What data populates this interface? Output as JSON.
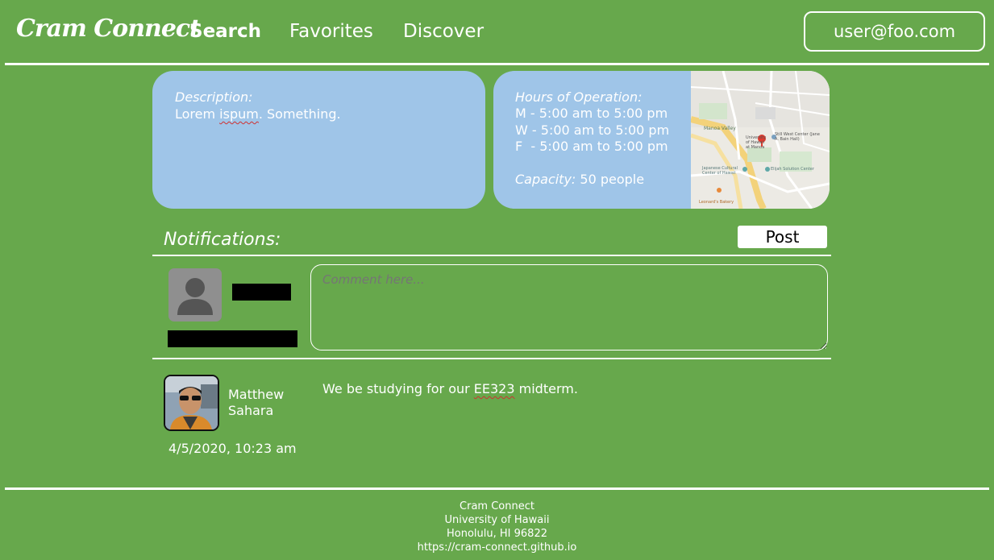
{
  "navbar": {
    "brand": "Cram Connect",
    "links": [
      "Search",
      "Favorites",
      "Discover"
    ],
    "user": "user@foo.com"
  },
  "description_card": {
    "label": "Description:",
    "text_word1": "Lorem",
    "text_word2": "ispum",
    "text_rest": ". Something."
  },
  "hours_card": {
    "label": "Hours of Operation:",
    "lines": [
      "M - 5:00 am to 5:00 pm",
      "W - 5:00 am to 5:00 pm",
      "F  - 5:00 am to 5:00 pm"
    ],
    "capacity_label": "Capacity:",
    "capacity_value": " 50 people"
  },
  "map": {
    "labels": [
      "Manoa Valley",
      "University of Hawaii at Manoa",
      "Still West Center (Jane A. Bain Hall)",
      "Japanese Cultural Center of Hawaii",
      "Elijah Solution Center",
      "Leonard's Bakery"
    ]
  },
  "notifications": {
    "title": "Notifications:",
    "post_button": "Post",
    "comment_placeholder": "Comment here..."
  },
  "posted_note": {
    "name": "Matthew Sahara",
    "date": "4/5/2020, 10:23 am",
    "text_before": "We be studying for our ",
    "text_highlight": "EE323",
    "text_after": " midterm."
  },
  "footer": {
    "lines": [
      "Cram Connect",
      "University of Hawaii",
      "Honolulu, HI 96822",
      "https://cram-connect.github.io"
    ]
  },
  "colors": {
    "background": "#67a84c",
    "card": "#9fc5e8",
    "text": "#ffffff"
  }
}
